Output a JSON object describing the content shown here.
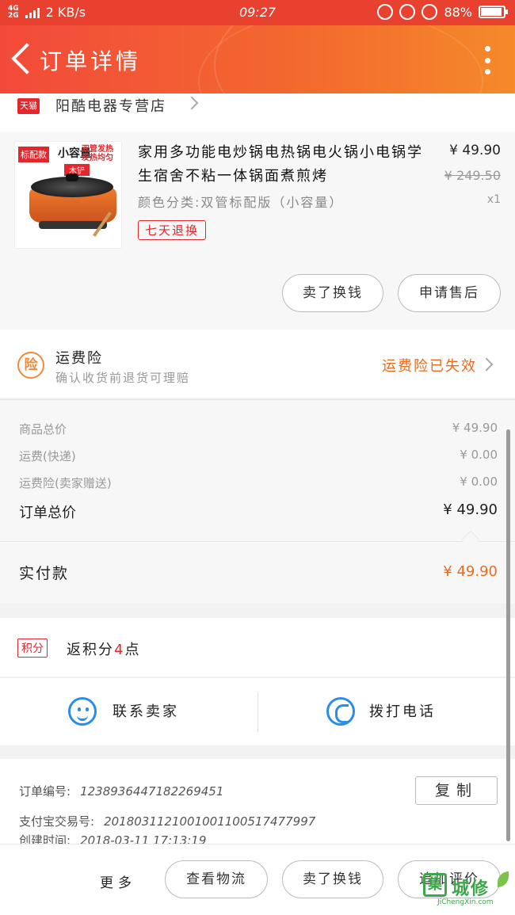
{
  "status_bar": {
    "net": "4G\n2G",
    "speed": "2 KB/s",
    "time": "09:27",
    "battery": "88%"
  },
  "header": {
    "title": "订单详情",
    "back_icon": "chevron-left-icon",
    "more_icon": "more-vertical-icon"
  },
  "shop": {
    "platform_badge": "天猫",
    "name": "阳酷电器专营店"
  },
  "product": {
    "title": "家用多功能电炒锅电热锅电火锅小电锅学生宿舍不粘一体锅面煮煎烤",
    "sku": "颜色分类:双管标配版（小容量）",
    "price": "¥ 49.90",
    "original_price": "¥ 249.50",
    "qty": "x1",
    "return_badge": "七天退换",
    "image_labels": {
      "tag1": "标配款",
      "tag2": "小容量",
      "tag3": "双管发热 发热均匀",
      "tag4": "木铲"
    },
    "actions": {
      "sell": "卖了换钱",
      "after_sale": "申请售后"
    }
  },
  "insurance": {
    "icon_label": "险",
    "title": "运费险",
    "subtitle": "确认收货前退货可理赔",
    "status": "运费险已失效"
  },
  "prices": {
    "rows": [
      {
        "label": "商品总价",
        "value": "¥ 49.90"
      },
      {
        "label": "运费(快递)",
        "value": "¥ 0.00"
      },
      {
        "label": "运费险(卖家赠送)",
        "value": "¥ 0.00"
      }
    ],
    "total_label": "订单总价",
    "total_value": "¥ 49.90",
    "paid_label": "实付款",
    "paid_value": "¥ 49.90"
  },
  "points": {
    "badge": "积分",
    "text_prefix": "返积分",
    "count": "4",
    "text_suffix": "点"
  },
  "contact": {
    "seller": "联系卖家",
    "phone": "拨打电话"
  },
  "order": {
    "id_label": "订单编号:",
    "id_value": "1238936447182269451",
    "alipay_label": "支付宝交易号:",
    "alipay_value": "2018031121001001100517477997",
    "created_label": "创建时间:",
    "created_value": "2018-03-11 17:13:19",
    "copy": "复制"
  },
  "bottom": {
    "more": "更多",
    "logistics": "查看物流",
    "sell": "卖了换钱",
    "review": "追加评价"
  },
  "watermark": {
    "cn": "城修",
    "icon_text": "集",
    "en": "JiChengXin.com"
  },
  "colors": {
    "brand_red": "#e3272d",
    "header_gradient_start": "#f24a3a",
    "orange": "#ec6a1e",
    "link_blue": "#2a8ee8"
  }
}
